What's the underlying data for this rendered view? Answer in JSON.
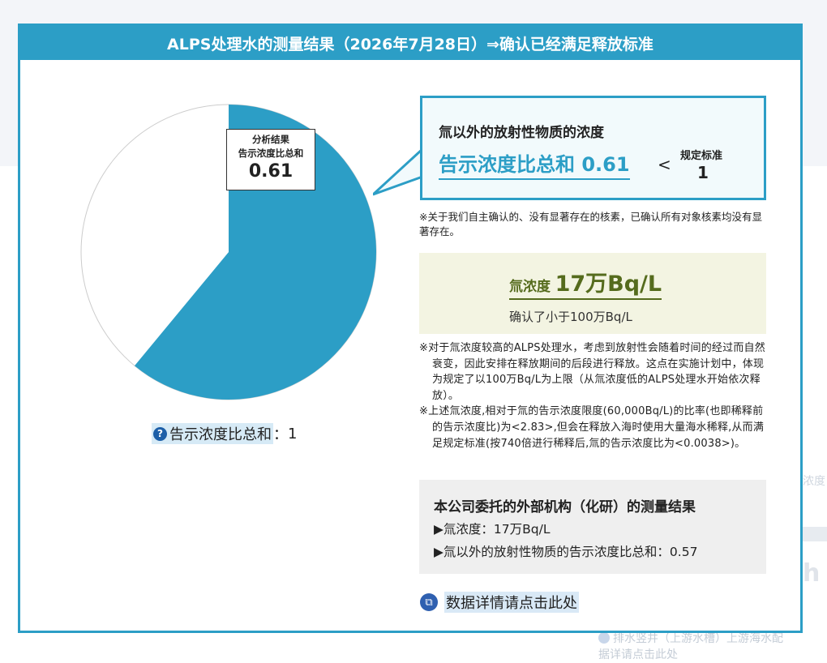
{
  "header": {
    "title": "ALPS处理水的测量结果（2026年7月28日）⇒确认已经满足释放标准"
  },
  "pie": {
    "label_line1": "分析结果",
    "label_line2": "告示浓度比总和",
    "value": "0.61",
    "ratio": 0.61,
    "colors": {
      "filled": "#2c9ec6",
      "remaining": "#ffffff",
      "outline": "#cccccc"
    }
  },
  "legend": {
    "icon": "question-circle-icon",
    "label": "告示浓度比总和",
    "sep": "：",
    "value": "1"
  },
  "callout": {
    "title": "氚以外的放射性物质的浓度",
    "highlight": "告示浓度比总和 0.61",
    "compare": "<",
    "std_label": "规定标准",
    "std_value": "1"
  },
  "note1": "※关于我们自主确认的、没有显著存在的核素，已确认所有对象核素均没有显著存在。",
  "tritium": {
    "label": "氚浓度",
    "value": "17万Bq/L",
    "sub": "确认了小于100万Bq/L",
    "color": "#556b1d"
  },
  "note2": {
    "p1": "※对于氚浓度较高的ALPS处理水，考虑到放射性会随着时间的经过而自然衰变，因此安排在释放期间的后段进行释放。这点在实施计划中，体现为规定了以100万Bq/L为上限（从氚浓度低的ALPS处理水开始依次释放）。",
    "p2": "※上述氚浓度,相对于氚的告示浓度限度(60,000Bq/L)的比率(也即稀释前的告示浓度比)为<2.83>,但会在释放入海时使用大量海水稀释,从而满足规定标准(按740倍进行稀释后,氚的告示浓度比为<0.0038>)。"
  },
  "external": {
    "heading": "本公司委托的外部机构（化研）的测量结果",
    "item1": "▶氚浓度：17万Bq/L",
    "item2": "▶氚以外的放射性物质的告示浓度比总和：0.57"
  },
  "detail_link": {
    "icon": "external-window-icon",
    "label": "数据详情请点击此处"
  },
  "background": {
    "right_text": "浓度",
    "bottom_line1": "排水竖井（上游水槽）上游海水配",
    "bottom_line2": "据详请点击此处"
  }
}
